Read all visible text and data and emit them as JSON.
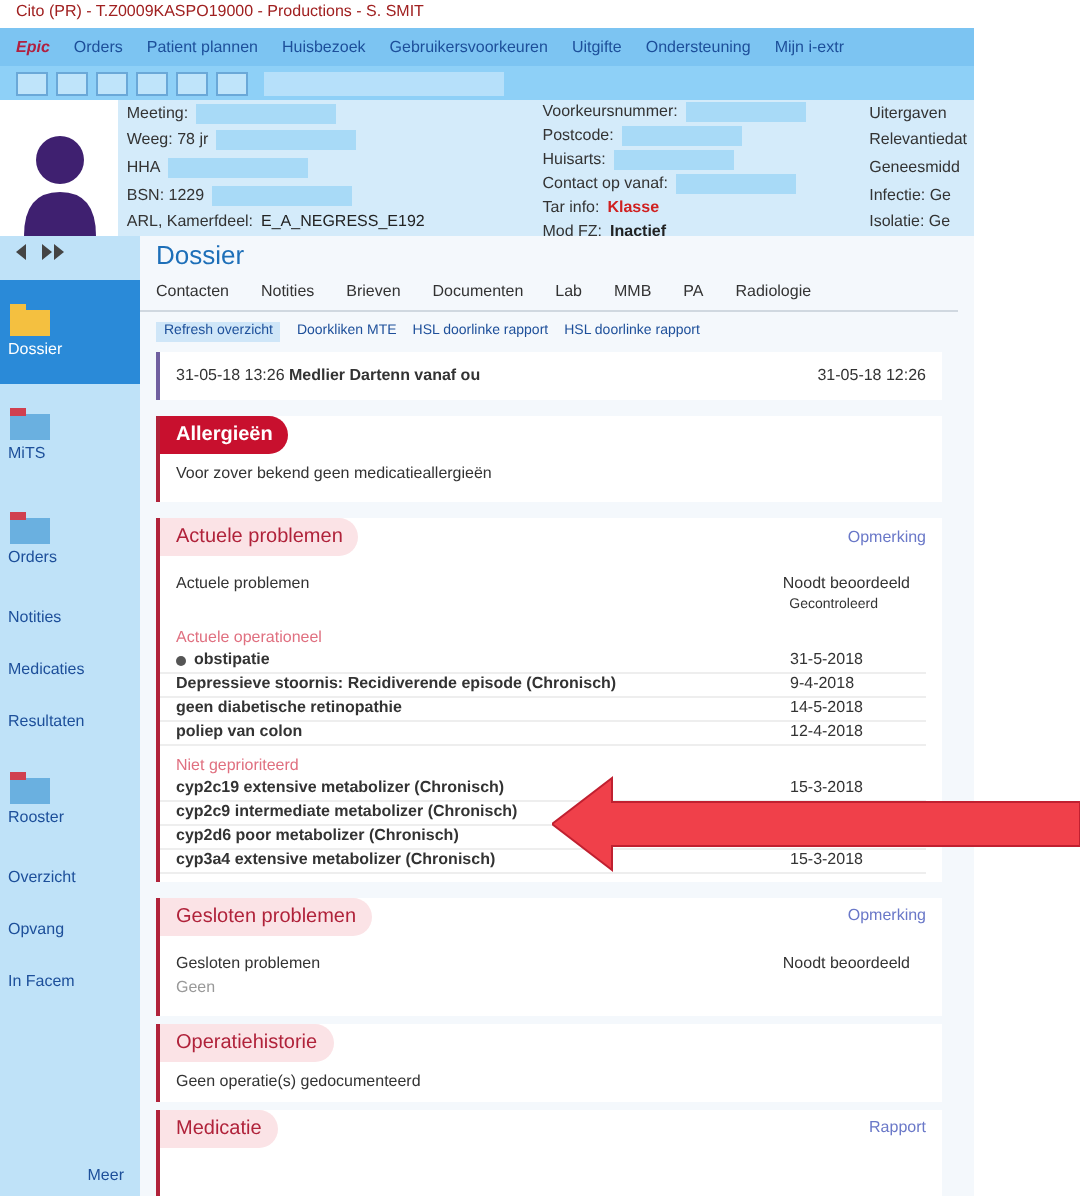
{
  "window": {
    "title": "Cito (PR) - T.Z0009KASPO19000 - Productions - S. SMIT"
  },
  "toolbar": [
    "Epic",
    "Orders",
    "Patient plannen",
    "Huisbezoek",
    "Gebruikersvoorkeuren",
    "Uitgifte",
    "Ondersteuning",
    "Mijn i-extr"
  ],
  "patient": {
    "left": [
      {
        "label": "Meeting:"
      },
      {
        "label": "Weeg: 78 jr"
      },
      {
        "label": "HHA"
      },
      {
        "label": "BSN: 1229"
      },
      {
        "label": "ARL, Kamerfdeel:",
        "value": "E_A_NEGRESS_E192"
      }
    ],
    "middle": [
      {
        "label": "Voorkeursnummer:"
      },
      {
        "label": "Postcode:"
      },
      {
        "label": "Huisarts:"
      },
      {
        "label": "Contact op vanaf:"
      },
      {
        "label": "Tar info:",
        "value": "Klasse",
        "alert": true
      },
      {
        "label": "Mod FZ:",
        "value": "Inactief",
        "alert": false
      }
    ],
    "right": [
      "Uitergaven",
      "Relevantiedat",
      "Geneesmidd",
      "Infectie: Ge",
      "Isolatie: Ge"
    ]
  },
  "sidebar": [
    {
      "kind": "icon",
      "label": "Dossier",
      "selected": true
    },
    {
      "kind": "icon",
      "label": "MiTS",
      "selected": false
    },
    {
      "kind": "icon",
      "label": "Orders",
      "selected": false
    },
    {
      "kind": "text",
      "label": "Notities",
      "selected": false
    },
    {
      "kind": "text",
      "label": "Medicaties",
      "selected": false
    },
    {
      "kind": "text",
      "label": "Resultaten",
      "selected": false
    },
    {
      "kind": "icon",
      "label": "Rooster",
      "selected": false
    },
    {
      "kind": "text",
      "label": "Overzicht",
      "selected": false
    },
    {
      "kind": "text",
      "label": "Opvang",
      "selected": false
    },
    {
      "kind": "text",
      "label": "In Facem",
      "selected": false
    }
  ],
  "sidebar_more": "Meer",
  "activity": {
    "title": "Dossier",
    "tabs": [
      "Contacten",
      "Notities",
      "Brieven",
      "Documenten",
      "Lab",
      "MMB",
      "PA",
      "Radiologie"
    ],
    "actions": [
      "Refresh overzicht",
      "Doorkliken MTE",
      "HSL doorlinke rapport",
      "HSL doorlinke rapport"
    ]
  },
  "note": {
    "time": "31-05-18 13:26",
    "text": "Medlier Dartenn vanaf ou",
    "right_time": "31-05-18 12:26"
  },
  "allergies": {
    "title": "Allergieën",
    "text": "Voor zover bekend geen medicatieallergieën"
  },
  "problems": {
    "title": "Actuele problemen",
    "link": "Opmerking",
    "column": "Actuele problemen",
    "right_header": "Noodt beoordeeld",
    "right_sub": "Gecontroleerd",
    "rows": [
      {
        "kind": "group",
        "text": "Actuele operationeel"
      },
      {
        "kind": "item",
        "text": "obstipatie",
        "date": "31-5-2018",
        "bullet": true
      },
      {
        "kind": "item",
        "text": "Depressieve stoornis: Recidiverende episode (Chronisch)",
        "date": "9-4-2018",
        "bullet": false
      },
      {
        "kind": "item",
        "text": "geen diabetische retinopathie",
        "date": "14-5-2018",
        "bullet": false
      },
      {
        "kind": "item",
        "text": "poliep van colon",
        "date": "12-4-2018",
        "bullet": false
      },
      {
        "kind": "group",
        "text": "Niet geprioriteerd"
      },
      {
        "kind": "item",
        "text": "cyp2c19 extensive metabolizer (Chronisch)",
        "date": "15-3-2018",
        "bullet": false
      },
      {
        "kind": "item",
        "text": "cyp2c9 intermediate metabolizer (Chronisch)",
        "bullet": false
      },
      {
        "kind": "item",
        "text": "cyp2d6 poor metabolizer (Chronisch)",
        "bullet": false
      },
      {
        "kind": "item",
        "text": "cyp3a4 extensive metabolizer (Chronisch)",
        "date": "15-3-2018",
        "bullet": false
      }
    ]
  },
  "closed": {
    "title": "Gesloten problemen",
    "link": "Opmerking",
    "column": "Gesloten problemen",
    "right_header": "Noodt beoordeeld",
    "text": "Geen"
  },
  "surgery": {
    "title": "Operatiehistorie",
    "text": "Geen operatie(s) gedocumenteerd"
  },
  "medication": {
    "title": "Medicatie",
    "link": "Rapport"
  }
}
